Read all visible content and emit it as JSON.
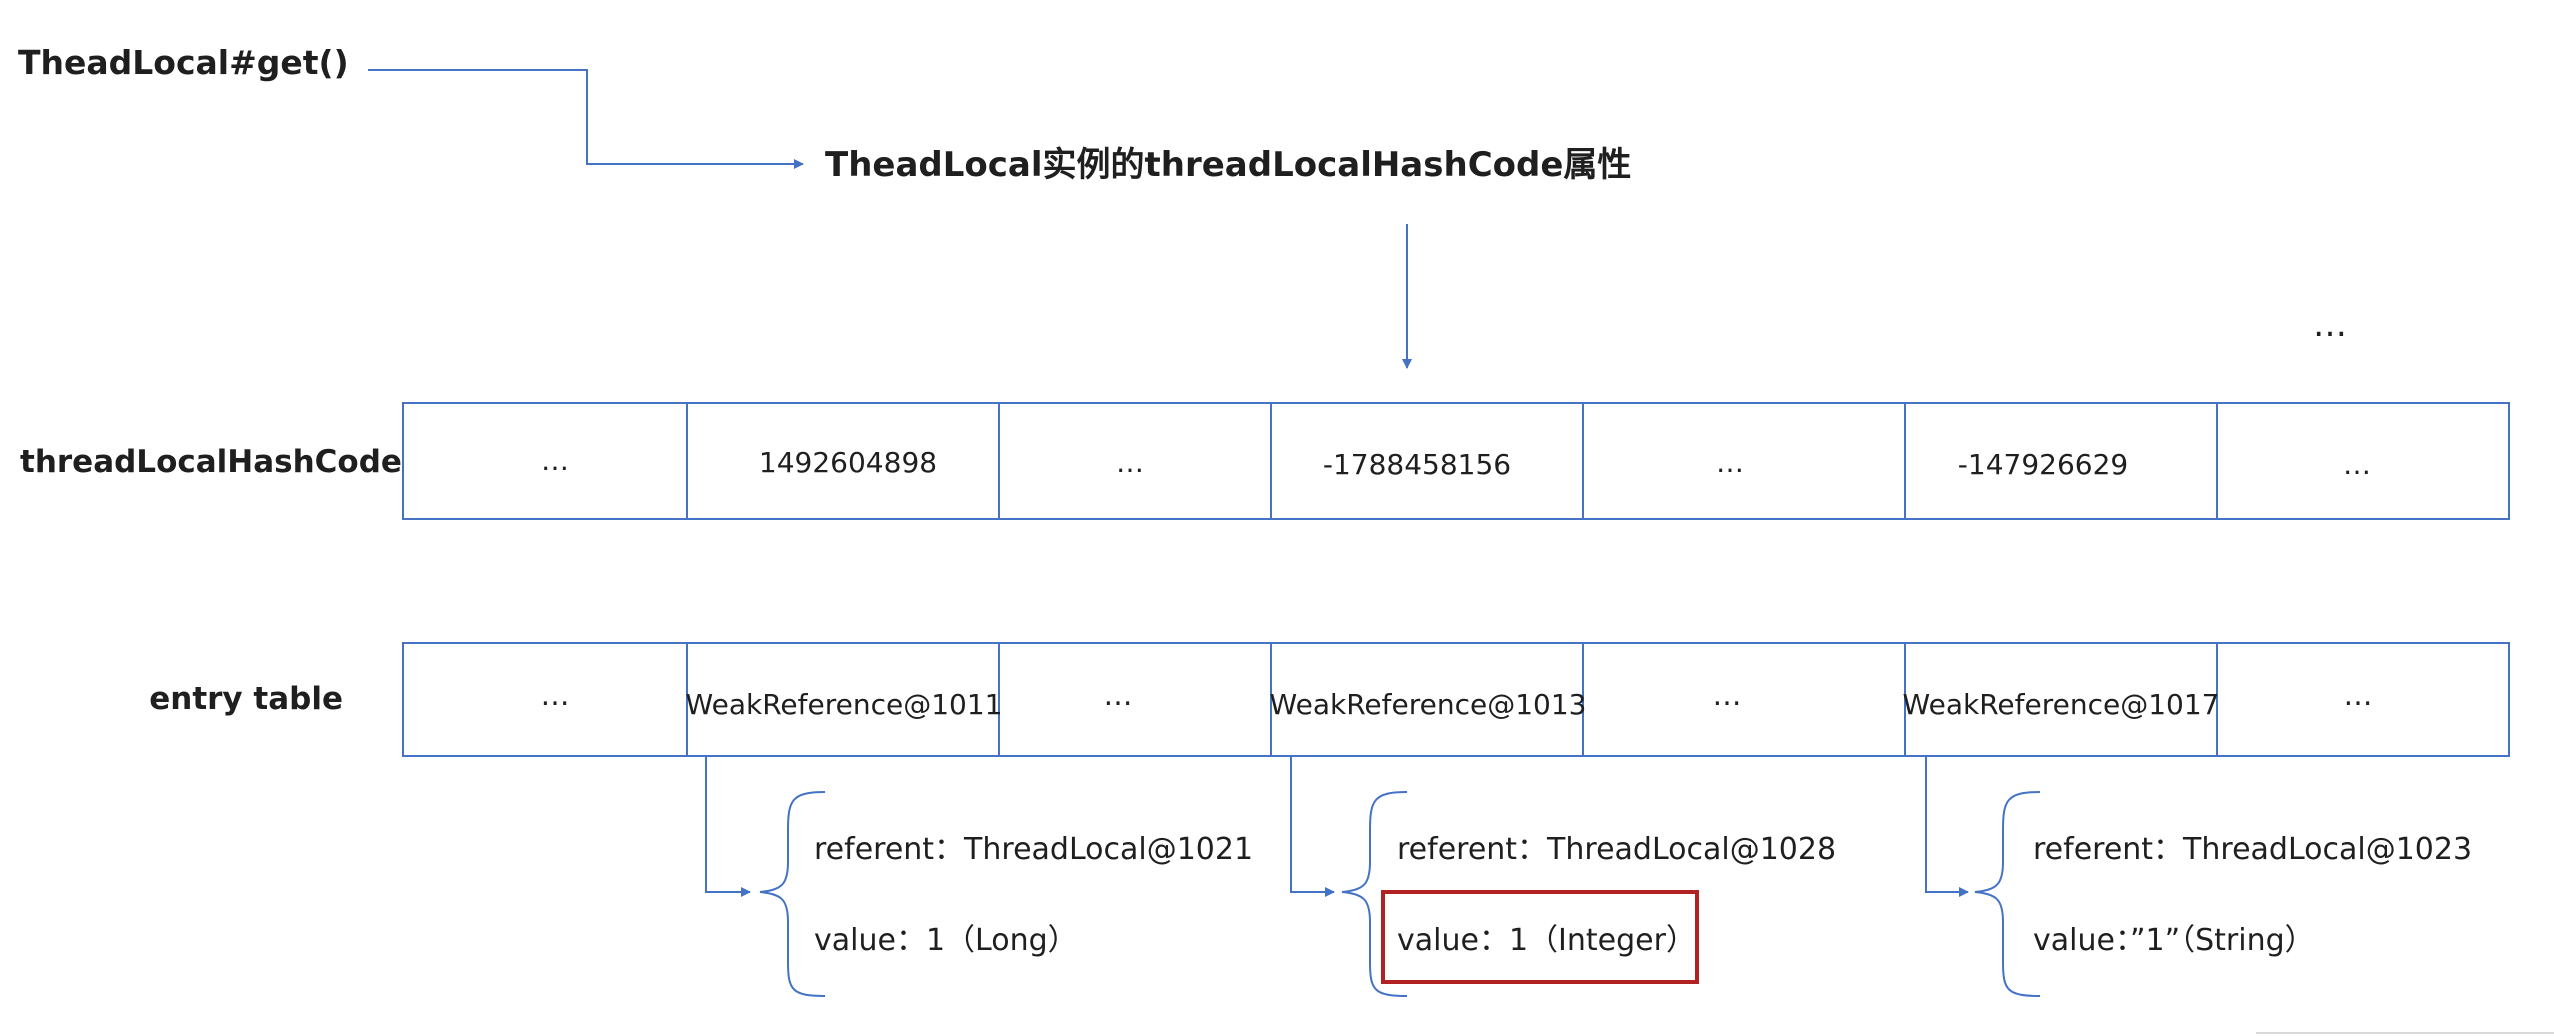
{
  "header": {
    "method_label": "TheadLocal#get()",
    "property_label": "TheadLocal实例的threadLocalHashCode属性"
  },
  "overflow_marker": "…",
  "hash_row": {
    "label": "threadLocalHashCode",
    "cells": [
      "…",
      "1492604898",
      "…",
      "-1788458156",
      "…",
      "-147926629",
      "…"
    ]
  },
  "entry_row": {
    "label": "entry table",
    "cells": [
      "…",
      "WeakReference@1011",
      "…",
      "WeakReference@1013",
      "…",
      "WeakReference@1017",
      "…"
    ]
  },
  "entries": [
    {
      "referent": "referent：ThreadLocal@1021",
      "value": "value：1（Long）",
      "highlighted": false
    },
    {
      "referent": "referent：ThreadLocal@1028",
      "value": "value：1（Integer）",
      "highlighted": true
    },
    {
      "referent": "referent：ThreadLocal@1023",
      "value": "value：”1”（String）",
      "highlighted": false
    }
  ],
  "colors": {
    "line": "#4472c4",
    "highlight": "#b22222",
    "text": "#1f1f1f"
  }
}
